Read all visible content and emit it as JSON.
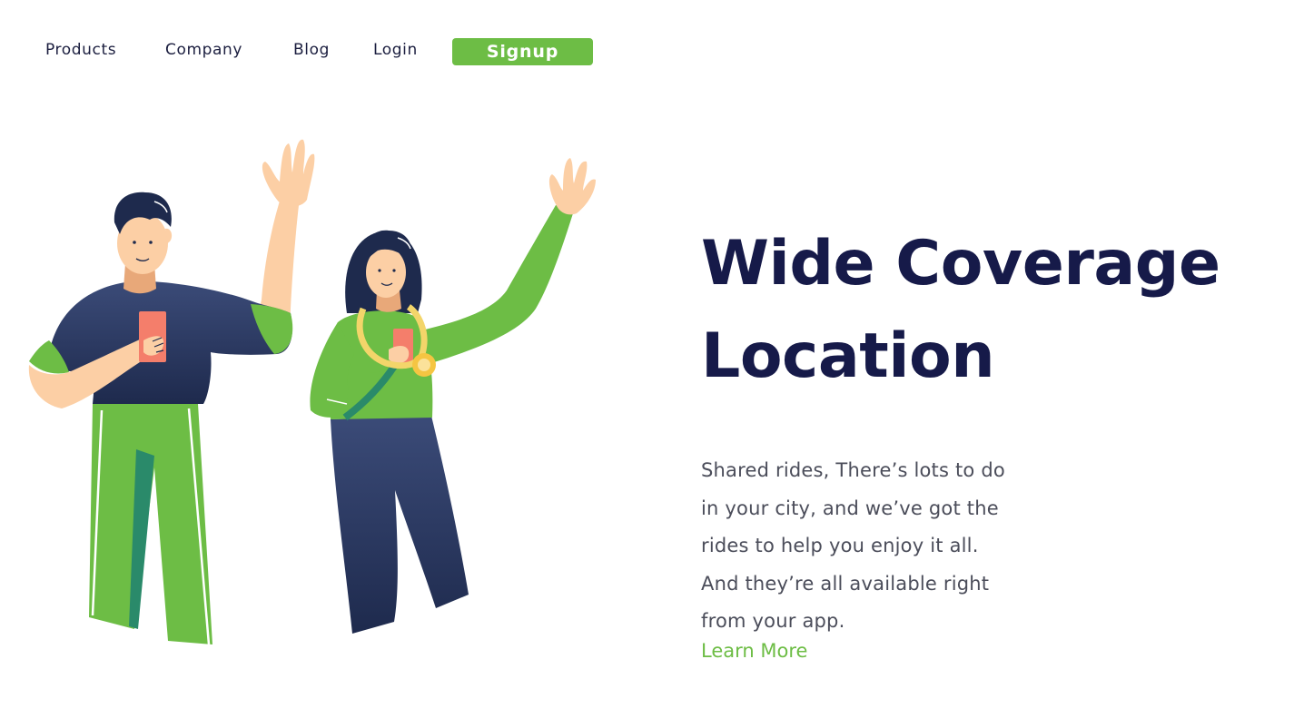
{
  "nav": {
    "products": "Products",
    "company": "Company",
    "blog": "Blog",
    "login": "Login",
    "signup": "Signup"
  },
  "hero": {
    "title_line1": "Wide Coverage",
    "title_line2": "Location",
    "body_lines": [
      "Shared rides, There’s lots to do",
      "in your city, and we’ve got the",
      "rides to help you enjoy it all.",
      "And they’re all available right",
      "from your app."
    ],
    "learn_more": "Learn More"
  },
  "colors": {
    "accent": "#6dbd45",
    "heading": "#161a49",
    "text": "#4b4d5a",
    "shirt_navy": "#2c3b62",
    "skin": "#fccfa5",
    "phone": "#f47e6b"
  }
}
